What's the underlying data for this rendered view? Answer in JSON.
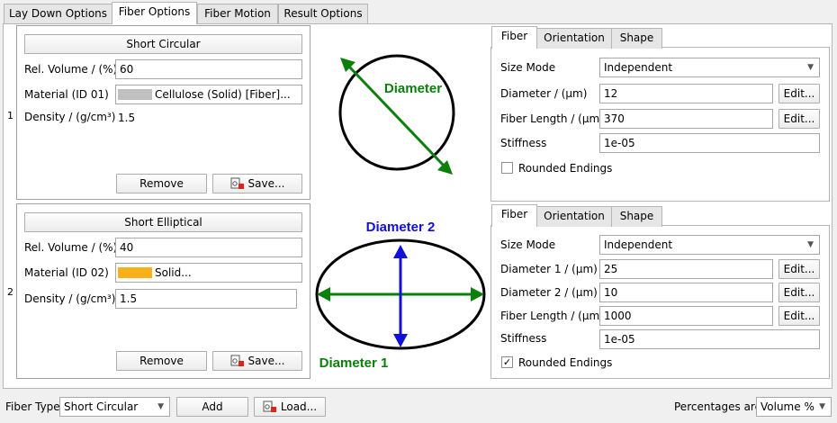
{
  "top_tabs": [
    "Lay Down Options",
    "Fiber Options",
    "Fiber Motion",
    "Result Options"
  ],
  "rows": [
    {
      "index": "1",
      "type_button": "Short Circular",
      "rel_volume_label": "Rel. Volume / (%)",
      "rel_volume_value": "60",
      "material_label": "Material (ID 01)",
      "material_value": "Cellulose (Solid) [Fiber]...",
      "material_color": "#c0c0c0",
      "density_label": "Density / (g/cm³)",
      "density_value": "1.5",
      "remove_label": "Remove",
      "save_label": "Save...",
      "diagram_labels": [
        "Diameter"
      ],
      "subtabs": [
        "Fiber",
        "Orientation",
        "Shape"
      ],
      "size_mode_label": "Size Mode",
      "size_mode_value": "Independent",
      "params": [
        {
          "label": "Diameter / (µm)",
          "value": "12",
          "edit": "Edit..."
        },
        {
          "label": "Fiber Length / (µm)",
          "value": "370",
          "edit": "Edit..."
        }
      ],
      "stiffness_label": "Stiffness",
      "stiffness_value": "1e-05",
      "rounded_label": "Rounded Endings",
      "rounded_checked": false
    },
    {
      "index": "2",
      "type_button": "Short Elliptical",
      "rel_volume_label": "Rel. Volume / (%)",
      "rel_volume_value": "40",
      "material_label": "Material (ID 02)",
      "material_value": "Solid...",
      "material_color": "#f7b21a",
      "density_label": "Density / (g/cm³)",
      "density_value": "1.5",
      "remove_label": "Remove",
      "save_label": "Save...",
      "diagram_labels": [
        "Diameter 2",
        "Diameter 1"
      ],
      "subtabs": [
        "Fiber",
        "Orientation",
        "Shape"
      ],
      "size_mode_label": "Size Mode",
      "size_mode_value": "Independent",
      "params": [
        {
          "label": "Diameter 1 / (µm)",
          "value": "25",
          "edit": "Edit..."
        },
        {
          "label": "Diameter 2 / (µm)",
          "value": "10",
          "edit": "Edit..."
        },
        {
          "label": "Fiber Length / (µm)",
          "value": "1000",
          "edit": "Edit..."
        }
      ],
      "stiffness_label": "Stiffness",
      "stiffness_value": "1e-05",
      "rounded_label": "Rounded Endings",
      "rounded_checked": true
    }
  ],
  "bottom": {
    "fiber_type_label": "Fiber Type",
    "fiber_type_value": "Short Circular",
    "add_label": "Add",
    "load_label": "Load...",
    "percentages_label": "Percentages are",
    "percentages_value": "Volume %"
  },
  "colors": {
    "green": "#0a7f0a",
    "blue": "#1010d8",
    "check": "✓"
  }
}
